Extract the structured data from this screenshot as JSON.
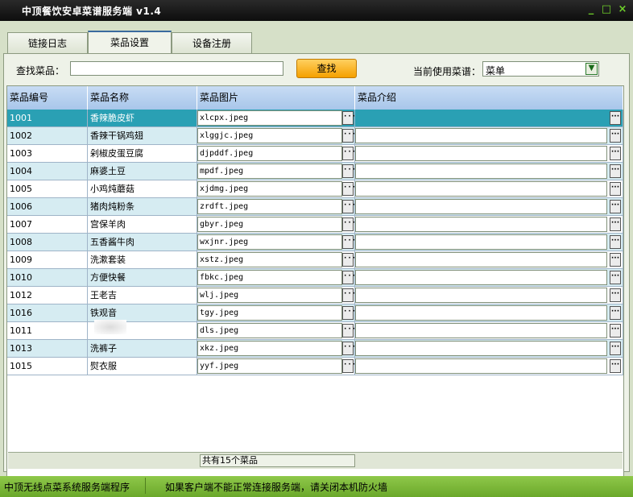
{
  "window": {
    "title": "中顶餐饮安卓菜谱服务端  v1.4",
    "min_icon": "minimize-icon",
    "max_icon": "maximize-icon",
    "close_icon": "close-icon"
  },
  "tabs": [
    {
      "label": "链接日志",
      "active": false
    },
    {
      "label": "菜品设置",
      "active": true
    },
    {
      "label": "设备注册",
      "active": false
    }
  ],
  "search": {
    "label": "查找菜品：",
    "value": "",
    "button_label": "查找"
  },
  "menu_select": {
    "label": "当前使用菜谱：",
    "value": "菜单"
  },
  "grid": {
    "columns": [
      "菜品编号",
      "菜品名称",
      "菜品图片",
      "菜品介绍"
    ],
    "rows": [
      {
        "id": "1001",
        "name": "香辣脆皮虾",
        "image": "xlcpx.jpeg",
        "intro": ""
      },
      {
        "id": "1002",
        "name": "香辣干锅鸡翅",
        "image": "xlggjc.jpeg",
        "intro": ""
      },
      {
        "id": "1003",
        "name": "剁椒皮蛋豆腐",
        "image": "djpddf.jpeg",
        "intro": ""
      },
      {
        "id": "1004",
        "name": "麻婆土豆",
        "image": "mpdf.jpeg",
        "intro": ""
      },
      {
        "id": "1005",
        "name": "小鸡炖蘑菇",
        "image": "xjdmg.jpeg",
        "intro": ""
      },
      {
        "id": "1006",
        "name": "猪肉炖粉条",
        "image": "zrdft.jpeg",
        "intro": ""
      },
      {
        "id": "1007",
        "name": "宫保羊肉",
        "image": "gbyr.jpeg",
        "intro": ""
      },
      {
        "id": "1008",
        "name": "五香酱牛肉",
        "image": "wxjnr.jpeg",
        "intro": ""
      },
      {
        "id": "1009",
        "name": "洗漱套装",
        "image": "xstz.jpeg",
        "intro": ""
      },
      {
        "id": "1010",
        "name": "方便快餐",
        "image": "fbkc.jpeg",
        "intro": ""
      },
      {
        "id": "1012",
        "name": "王老吉",
        "image": "wlj.jpeg",
        "intro": ""
      },
      {
        "id": "1016",
        "name": "铁观音",
        "image": "tgy.jpeg",
        "intro": ""
      },
      {
        "id": "1011",
        "name": "",
        "image": "dls.jpeg",
        "intro": ""
      },
      {
        "id": "1013",
        "name": "洗裤子",
        "image": "xkz.jpeg",
        "intro": ""
      },
      {
        "id": "1015",
        "name": "熨衣服",
        "image": "yyf.jpeg",
        "intro": ""
      }
    ],
    "selected_row": 0,
    "ellipsis": "···",
    "footer_count": "共有15个菜品"
  },
  "status": {
    "left": "中顶无线点菜系统服务端程序",
    "right": "如果客户端不能正常连接服务端，请关闭本机防火墙"
  },
  "colors": {
    "selected_row": "#2aa0b4",
    "alt_row": "#d6ecf2",
    "header": "#b0cbea",
    "status": "#7ab83a"
  }
}
